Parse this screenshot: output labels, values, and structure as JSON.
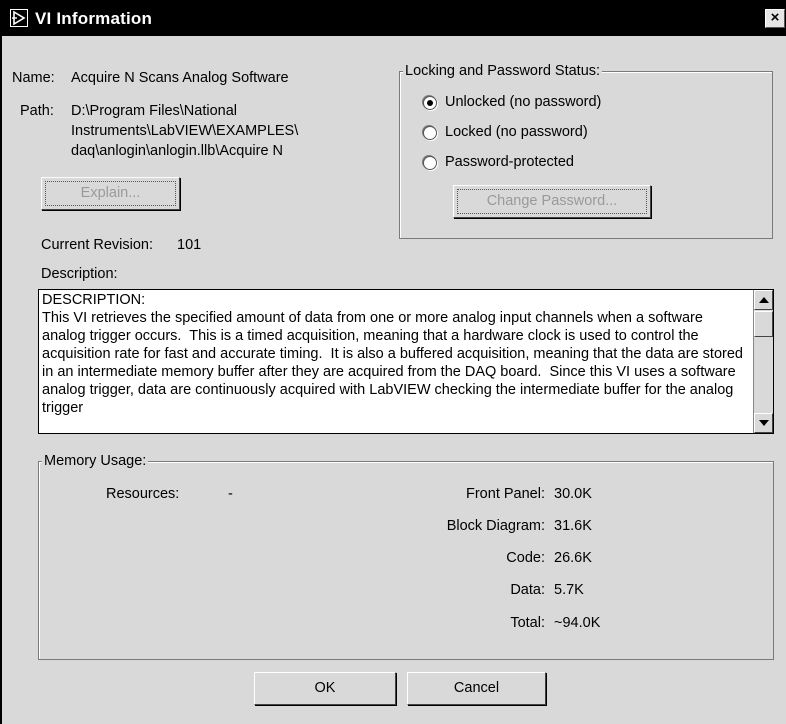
{
  "window": {
    "title": "VI Information",
    "close_glyph": "×"
  },
  "info": {
    "name_label": "Name:",
    "name_value": "Acquire N Scans Analog Software",
    "path_label": "Path:",
    "path_line1": "D:\\Program Files\\National",
    "path_line2": "Instruments\\LabVIEW\\EXAMPLES\\",
    "path_line3": "daq\\anlogin\\anlogin.llb\\Acquire N",
    "explain_button": "Explain...",
    "revision_label": "Current Revision:",
    "revision_value": "101",
    "description_label": "Description:"
  },
  "locking": {
    "title": "Locking and Password Status:",
    "options": [
      {
        "label": "Unlocked (no password)",
        "selected": true
      },
      {
        "label": "Locked (no password)",
        "selected": false
      },
      {
        "label": "Password-protected",
        "selected": false
      }
    ],
    "change_password_button": "Change Password..."
  },
  "description": {
    "text": "DESCRIPTION:\nThis VI retrieves the specified amount of data from one or more analog input channels when a software analog trigger occurs.  This is a timed acquisition, meaning that a hardware clock is used to control the acquisition rate for fast and accurate timing.  It is also a buffered acquisition, meaning that the data are stored in an intermediate memory buffer after they are acquired from the DAQ board.  Since this VI uses a software analog trigger, data are continuously acquired with LabVIEW checking the intermediate buffer for the analog trigger"
  },
  "memory": {
    "title": "Memory Usage:",
    "resources_label": "Resources:",
    "resources_value": "-",
    "rows": [
      {
        "label": "Front Panel:",
        "value": "30.0K"
      },
      {
        "label": "Block Diagram:",
        "value": "31.6K"
      },
      {
        "label": "Code:",
        "value": "26.6K"
      },
      {
        "label": "Data:",
        "value": "5.7K"
      },
      {
        "label": "Total:",
        "value": "~94.0K"
      }
    ]
  },
  "buttons": {
    "ok": "OK",
    "cancel": "Cancel"
  },
  "icons": {
    "window_icon": "labview-vi-icon",
    "close": "close-icon",
    "scroll_up": "arrow-up-icon",
    "scroll_down": "arrow-down-icon"
  }
}
